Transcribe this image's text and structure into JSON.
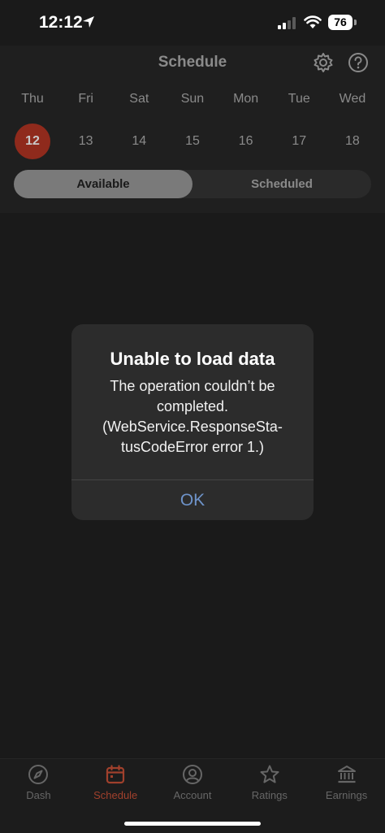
{
  "status_bar": {
    "time": "12:12",
    "battery": "76",
    "icons": [
      "location-arrow-icon",
      "cellular-signal-icon",
      "wifi-icon",
      "battery-icon"
    ]
  },
  "header": {
    "title": "Schedule",
    "icons": [
      "gear-icon",
      "help-icon"
    ]
  },
  "days": [
    {
      "name": "Thu",
      "num": "12",
      "selected": true
    },
    {
      "name": "Fri",
      "num": "13",
      "selected": false
    },
    {
      "name": "Sat",
      "num": "14",
      "selected": false
    },
    {
      "name": "Sun",
      "num": "15",
      "selected": false
    },
    {
      "name": "Mon",
      "num": "16",
      "selected": false
    },
    {
      "name": "Tue",
      "num": "17",
      "selected": false
    },
    {
      "name": "Wed",
      "num": "18",
      "selected": false
    }
  ],
  "segments": {
    "available": "Available",
    "scheduled": "Scheduled",
    "active": "available"
  },
  "alert": {
    "title": "Unable to load data",
    "message": "The operation couldn’t be completed. (WebService.ResponseSta-tusCodeError error 1.)",
    "ok": "OK"
  },
  "tabbar": {
    "tabs": [
      {
        "label": "Dash",
        "icon": "compass-icon"
      },
      {
        "label": "Schedule",
        "icon": "calendar-icon",
        "active": true
      },
      {
        "label": "Account",
        "icon": "account-icon"
      },
      {
        "label": "Ratings",
        "icon": "star-icon"
      },
      {
        "label": "Earnings",
        "icon": "bank-icon"
      }
    ]
  },
  "colors": {
    "accent": "#8f2a1c",
    "active_tab": "#a0402c",
    "link_blue": "#6e93c9",
    "background": "#1a1a1a"
  }
}
